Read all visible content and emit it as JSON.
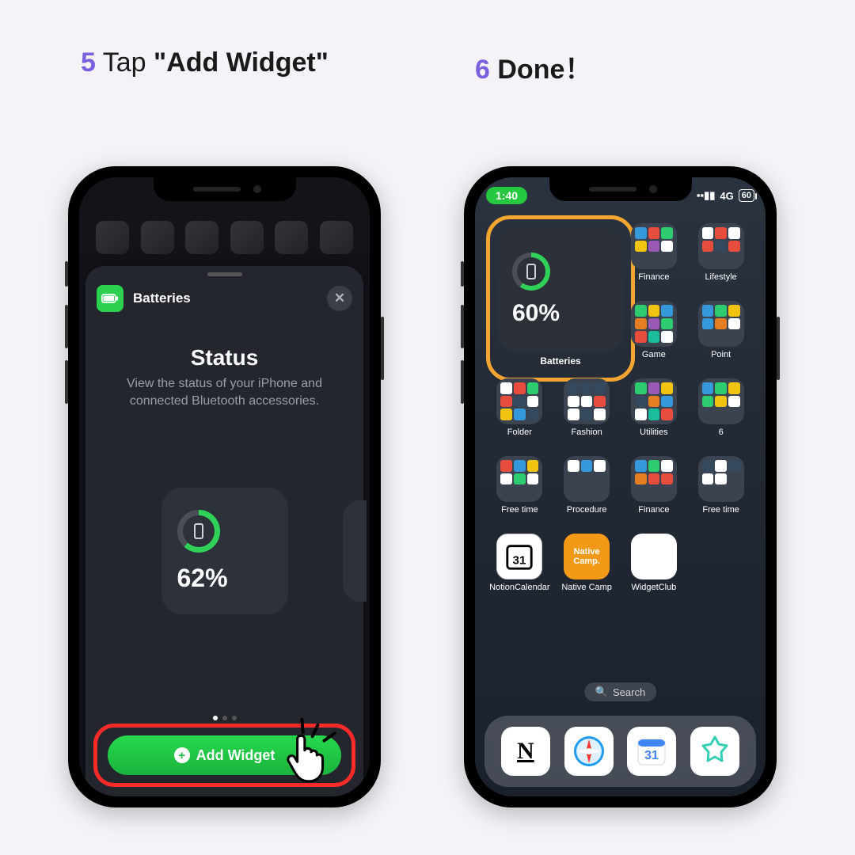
{
  "step5": {
    "num": "5",
    "text_pre": "Tap ",
    "text_bold": "\"Add Widget\"",
    "sheet": {
      "app_name": "Batteries",
      "title": "Status",
      "description": "View the status of your iPhone and connected Bluetooth accessories.",
      "percent": "62%",
      "add_button": "Add Widget"
    }
  },
  "step6": {
    "num": "6",
    "text_bold": "Done！",
    "status": {
      "time": "1:40",
      "net": "4G",
      "battery": "60"
    },
    "widget": {
      "percent": "60%",
      "label": "Batteries"
    },
    "folders": {
      "r1c3": "Finance",
      "r1c4": "Lifestyle",
      "r2c3": "Game",
      "r2c4": "Point",
      "r3c1": "Folder",
      "r3c2": "Fashion",
      "r3c3": "Utilities",
      "r3c4": "6",
      "r4c1": "Free time",
      "r4c2": "Procedure",
      "r4c3": "Finance",
      "r4c4": "Free time"
    },
    "apps": {
      "r5c1": "NotionCalendar",
      "r5c2": "Native Camp",
      "r5c3": "WidgetClub"
    },
    "search": "Search",
    "dock": [
      "Notion",
      "Safari",
      "Calendar",
      "WidgetClub"
    ]
  }
}
